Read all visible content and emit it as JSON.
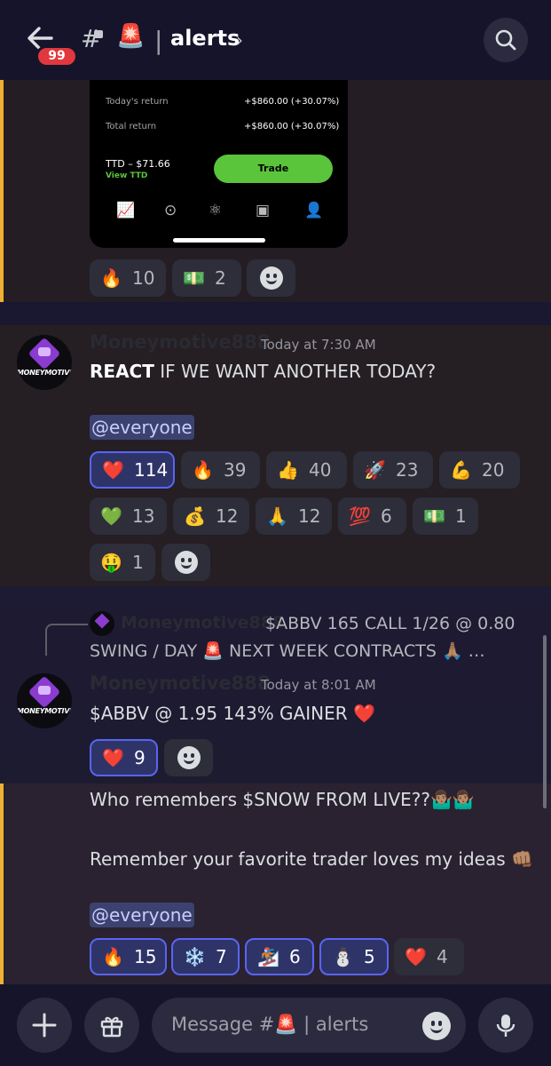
{
  "header": {
    "back_label": "←",
    "badge": "99",
    "hash": "#",
    "channel_emoji": "🚨",
    "separator": "|",
    "channel": "alerts",
    "chevron": "›"
  },
  "embed": {
    "todays_return_label": "Today's return",
    "todays_return_value": "+$860.00 (+30.07%)",
    "total_return_label": "Total return",
    "total_return_value": "+$860.00 (+30.07%)",
    "ticker_price": "TTD – $71.66",
    "view_link": "View TTD",
    "trade_button": "Trade"
  },
  "msg1_reactions": [
    {
      "emoji": "🔥",
      "count": "10"
    },
    {
      "emoji": "💵",
      "count": "2"
    }
  ],
  "msg2": {
    "author": "Moneymotive888",
    "timestamp": "Today at 7:30 AM",
    "text_bold": "REACT",
    "text_rest": " IF WE WANT ANOTHER TODAY?",
    "mention": "@everyone",
    "avatar_text": "MONEYMOTIVE",
    "reactions": [
      {
        "emoji": "❤️",
        "count": "114"
      },
      {
        "emoji": "🔥",
        "count": "39"
      },
      {
        "emoji": "👍",
        "count": "40"
      },
      {
        "emoji": "🚀",
        "count": "23"
      },
      {
        "emoji": "💪",
        "count": "20"
      },
      {
        "emoji": "💚",
        "count": "13"
      },
      {
        "emoji": "💰",
        "count": "12"
      },
      {
        "emoji": "🙏",
        "count": "12"
      },
      {
        "emoji": "💯",
        "count": "6"
      },
      {
        "emoji": "💵",
        "count": "1"
      },
      {
        "emoji": "🤑",
        "count": "1"
      }
    ]
  },
  "msg3": {
    "reply_author": "Moneymotive888",
    "reply_text": "$ABBV 165 CALL 1/26 @ 0.80",
    "reply_text2": "SWING / DAY 🚨  NEXT WEEK CONTRACTS 🙏🏽  …",
    "author": "Moneymotive888",
    "timestamp": "Today at 8:01 AM",
    "text": "$ABBV @ 1.95 143% GAINER ❤️",
    "avatar_text": "MONEYMOTIVE",
    "reactions": [
      {
        "emoji": "❤️",
        "count": "9"
      }
    ]
  },
  "msg4": {
    "line1": "Who remembers $SNOW FROM LIVE??🤷🏽‍♂️🤷🏽‍♂️",
    "line2": "Remember your favorite trader loves my ideas 👊🏽",
    "mention": "@everyone",
    "reactions": [
      {
        "emoji": "🔥",
        "count": "15"
      },
      {
        "emoji": "❄️",
        "count": "7"
      },
      {
        "emoji": "🏂",
        "count": "6"
      },
      {
        "emoji": "⛄",
        "count": "5"
      },
      {
        "emoji": "❤️",
        "count": "4"
      }
    ]
  },
  "composer": {
    "placeholder": "Message #🚨 | alerts"
  }
}
